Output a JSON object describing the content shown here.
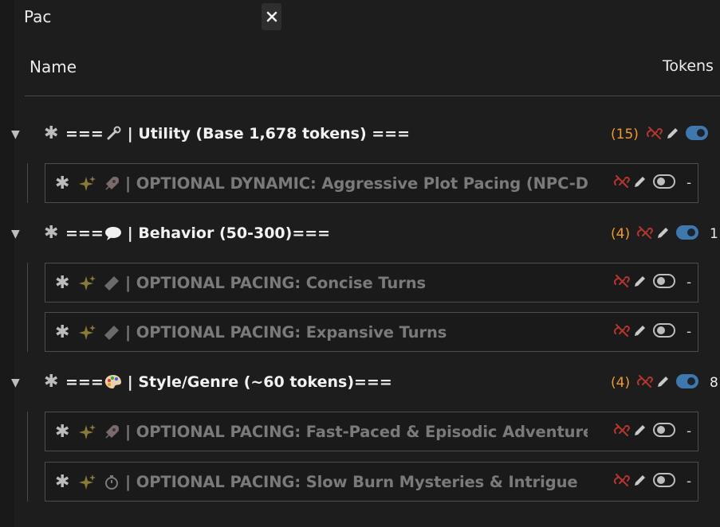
{
  "search": {
    "value": "Pac",
    "clear_label": "✕"
  },
  "columns": {
    "name": "Name",
    "tokens": "Tokens"
  },
  "groups": [
    {
      "title": "===🔧 | Utility (Base 1,678 tokens) ===",
      "prefix": "===",
      "icon": "wrench-icon",
      "label": "| Utility (Base 1,678 tokens) ===",
      "count": "(15)",
      "enabled": true,
      "tokens": "",
      "entries": [
        {
          "icon": "rocket-icon",
          "title": "| OPTIONAL DYNAMIC: Aggressive Plot Pacing (NPC-Dri...",
          "enabled": false,
          "tokens": "-"
        }
      ]
    },
    {
      "prefix": "===",
      "icon": "speech-bubble-icon",
      "label": "| Behavior (50-300)===",
      "count": "(4)",
      "enabled": true,
      "tokens": "1",
      "entries": [
        {
          "icon": "ruler-icon",
          "title": "| OPTIONAL PACING: Concise Turns",
          "enabled": false,
          "tokens": "-"
        },
        {
          "icon": "ruler-icon",
          "title": "| OPTIONAL PACING: Expansive Turns",
          "enabled": false,
          "tokens": "-"
        }
      ]
    },
    {
      "prefix": "===",
      "icon": "palette-icon",
      "label": "| Style/Genre (~60 tokens)===",
      "count": "(4)",
      "enabled": true,
      "tokens": "8",
      "entries": [
        {
          "icon": "rocket-icon",
          "title": "| OPTIONAL PACING: Fast-Paced & Episodic Adventures",
          "enabled": false,
          "tokens": "-"
        },
        {
          "icon": "stopwatch-icon",
          "title": "| OPTIONAL PACING: Slow Burn Mysteries & Intrigue",
          "enabled": false,
          "tokens": "-"
        }
      ]
    }
  ],
  "colors": {
    "count": "#f09a2a",
    "toggle_on": "#3f78ad",
    "unlink": "#b5352f"
  }
}
